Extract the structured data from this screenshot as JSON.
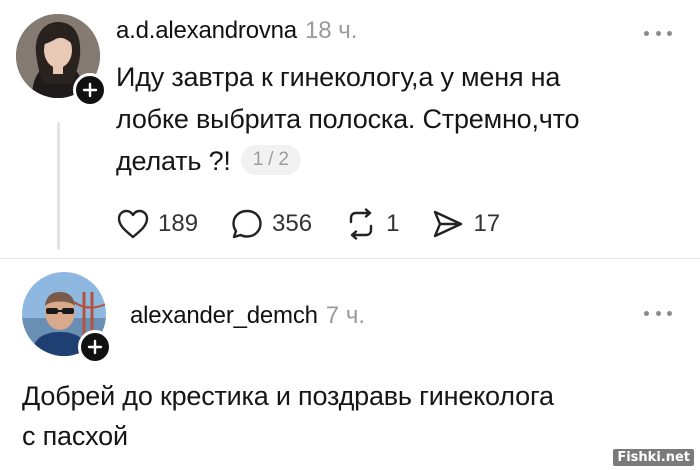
{
  "post": {
    "username": "a.d.alexandrovna",
    "time": "18 ч.",
    "text_line1": "Иду завтра к гинекологу,а у меня на",
    "text_line2": "лобке выбрита полоска. Стремно,что",
    "text_line3": "делать ?!",
    "page_indicator": "1 / 2",
    "actions": {
      "likes": "189",
      "comments": "356",
      "reposts": "1",
      "shares": "17"
    }
  },
  "reply": {
    "username": "alexander_demch",
    "time": "7 ч.",
    "text_line1": "Добрей до крестика и поздравь гинеколога",
    "text_line2": "с пасхой"
  },
  "watermark": "Fishki.net",
  "icons": {
    "like": "heart-icon",
    "comment": "comment-bubble-icon",
    "repost": "repost-icon",
    "share": "send-icon",
    "more": "more-horizontal-icon",
    "follow": "plus-icon"
  }
}
